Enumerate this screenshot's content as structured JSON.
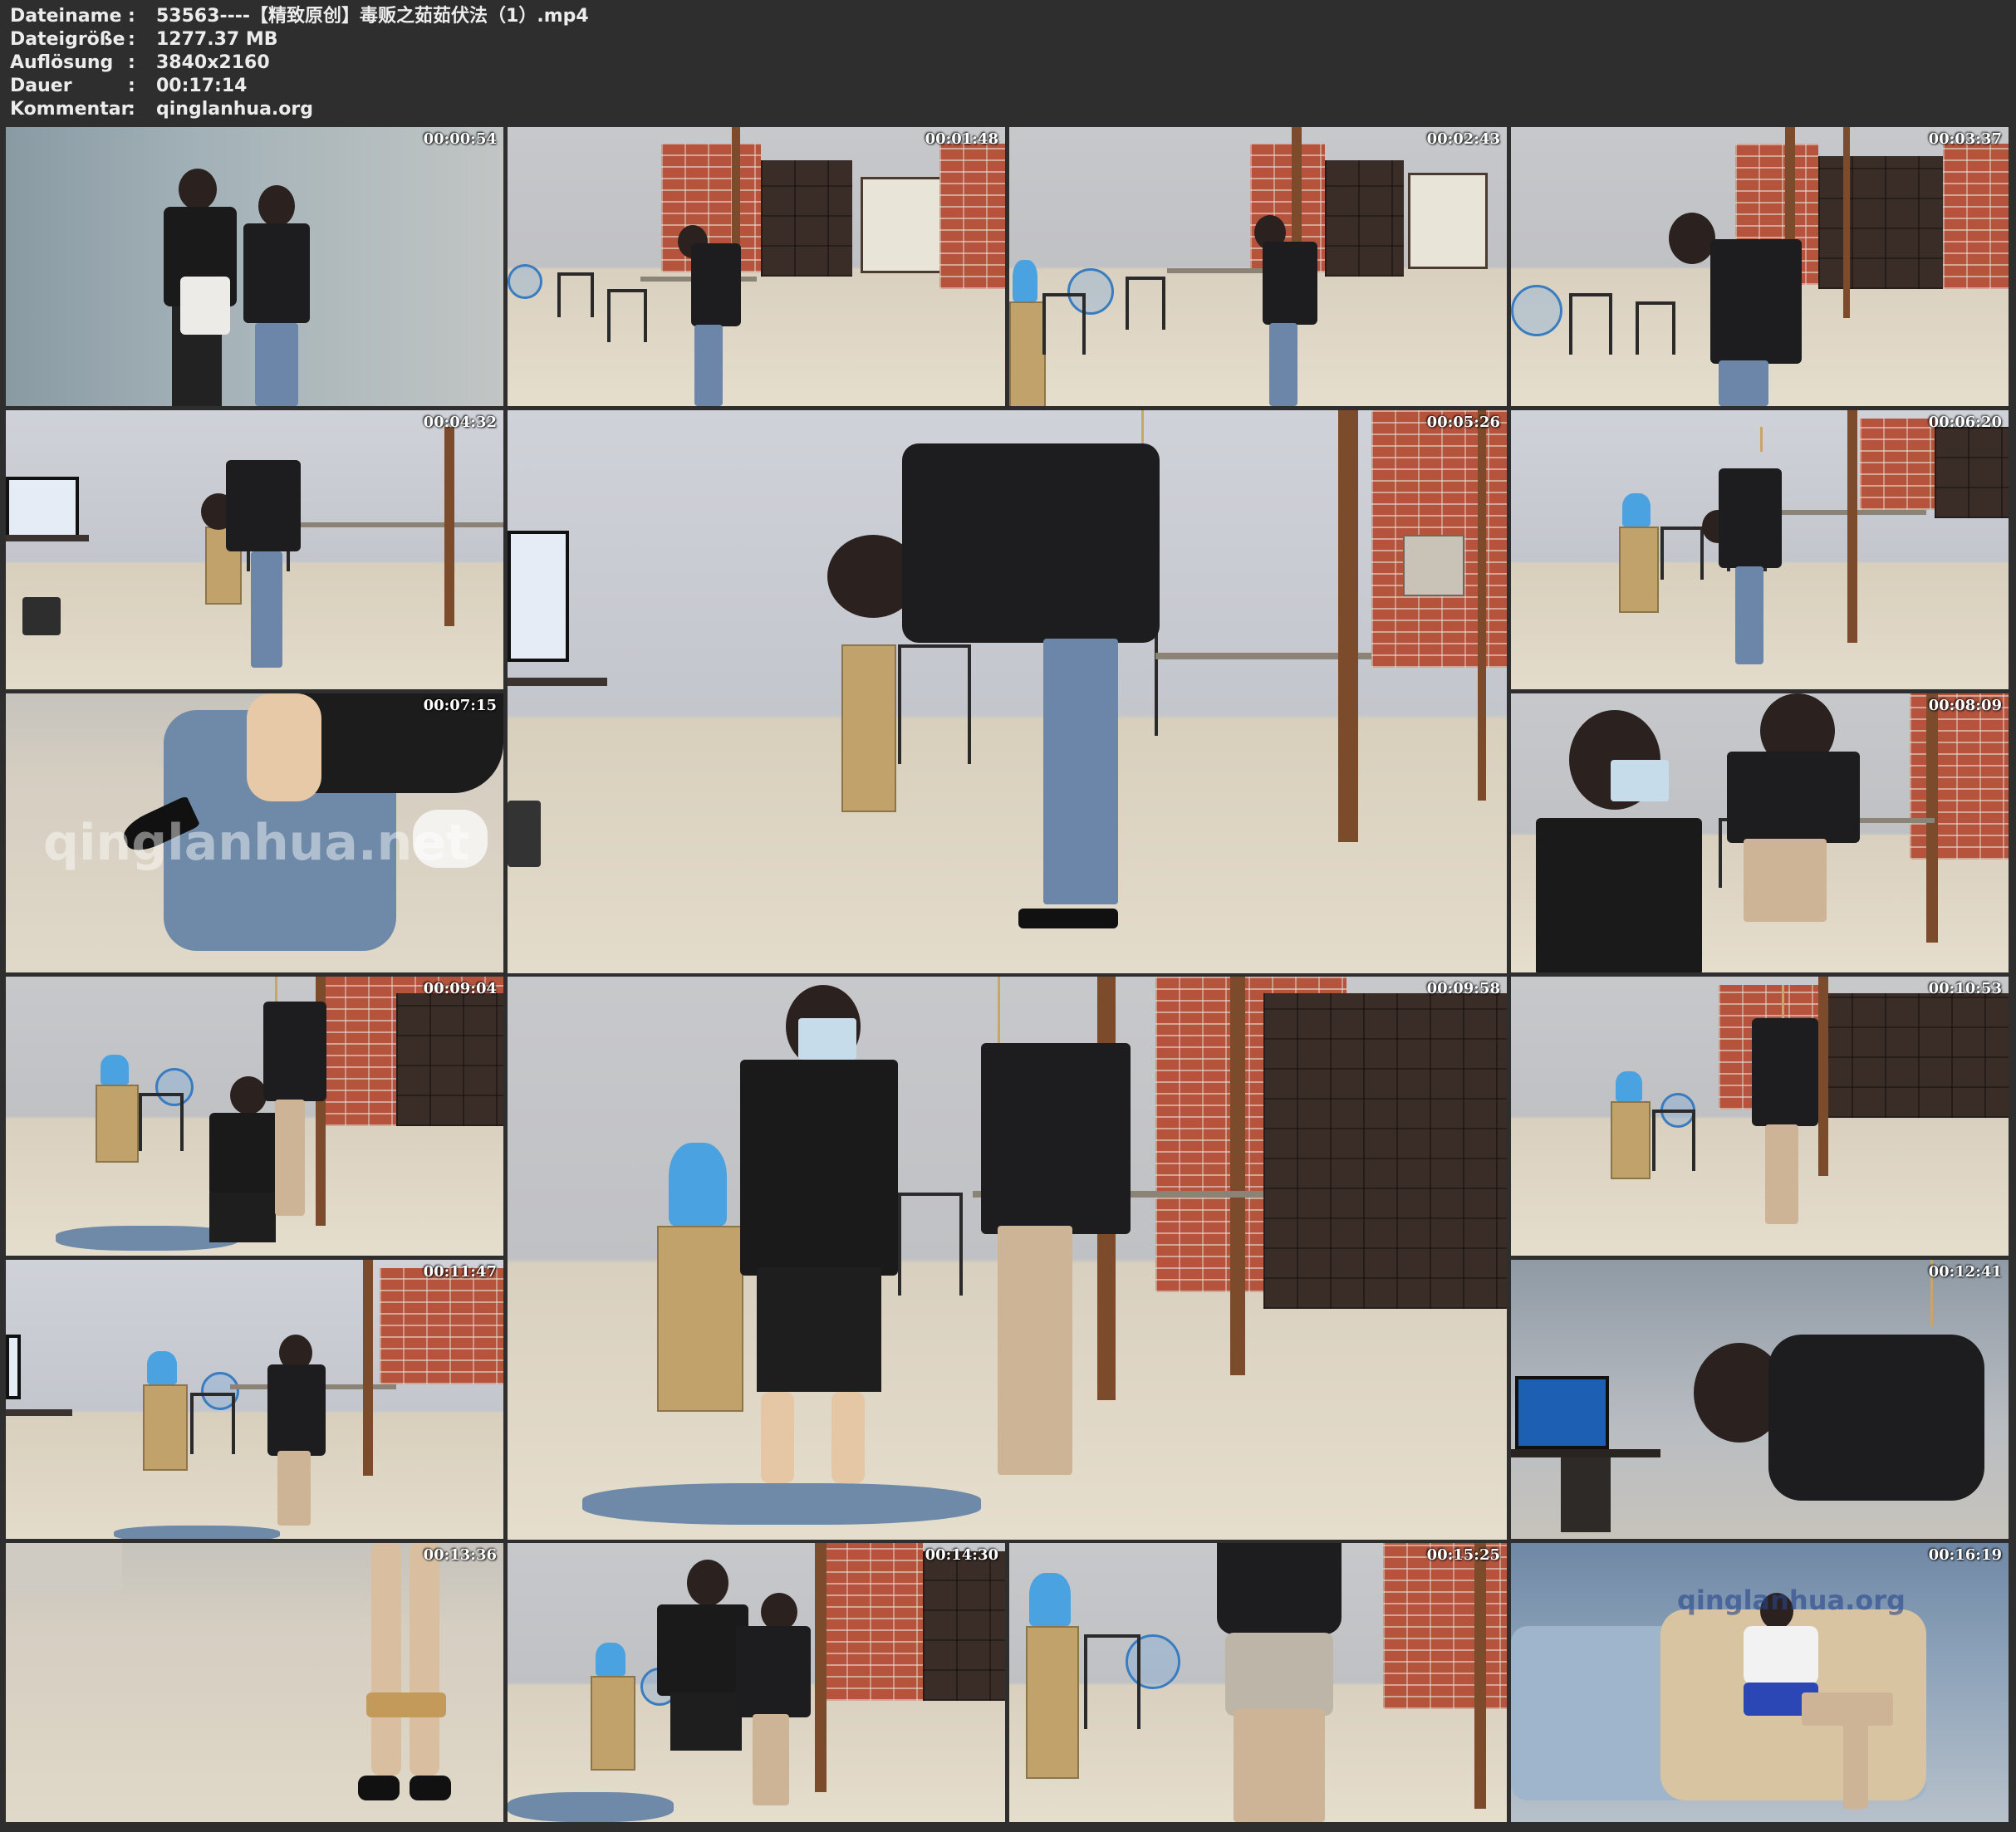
{
  "header": {
    "rows": [
      {
        "label": "Dateiname",
        "sep": ":",
        "value": "53563----【精致原创】毒贩之茹茹伏法（1）.mp4"
      },
      {
        "label": "Dateigröße",
        "sep": ":",
        "value": "1277.37 MB"
      },
      {
        "label": "Auflösung",
        "sep": ":",
        "value": "3840x2160"
      },
      {
        "label": "Dauer",
        "sep": ":",
        "value": "00:17:14"
      },
      {
        "label": "Kommentar",
        "sep": ":",
        "value": "qinglanhua.org"
      }
    ]
  },
  "thumbnails": [
    {
      "timestamp": "00:00:54",
      "scene": "stair"
    },
    {
      "timestamp": "00:01:48",
      "scene": "brick"
    },
    {
      "timestamp": "00:02:43",
      "scene": "brick"
    },
    {
      "timestamp": "00:03:37",
      "scene": "brick"
    },
    {
      "timestamp": "00:04:32",
      "scene": "office"
    },
    {
      "timestamp": "00:05:26",
      "scene": "office-large"
    },
    {
      "timestamp": "00:06:20",
      "scene": "office"
    },
    {
      "timestamp": "00:07:15",
      "scene": "floor"
    },
    {
      "timestamp": "00:08:09",
      "scene": "brick"
    },
    {
      "timestamp": "00:09:04",
      "scene": "brick"
    },
    {
      "timestamp": "00:09:58",
      "scene": "brick-large"
    },
    {
      "timestamp": "00:10:53",
      "scene": "brick"
    },
    {
      "timestamp": "00:11:47",
      "scene": "office"
    },
    {
      "timestamp": "00:12:41",
      "scene": "dark"
    },
    {
      "timestamp": "00:13:36",
      "scene": "floor"
    },
    {
      "timestamp": "00:14:30",
      "scene": "brick"
    },
    {
      "timestamp": "00:15:25",
      "scene": "brick"
    },
    {
      "timestamp": "00:16:19",
      "scene": "sofa"
    }
  ],
  "watermarks": {
    "thumb7": "qinglanhua.net",
    "thumb18": "qinglanhua.org"
  }
}
